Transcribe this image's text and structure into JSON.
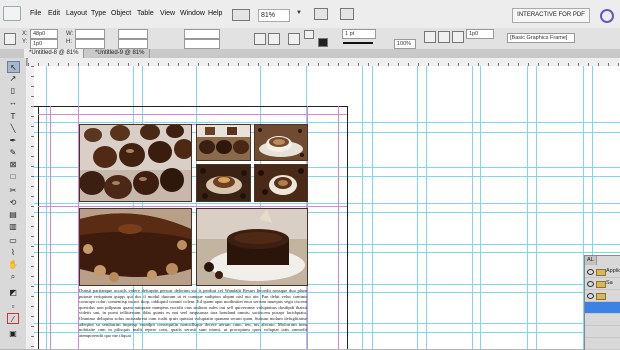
{
  "menubar": {
    "items": [
      "File",
      "Edit",
      "Layout",
      "Type",
      "Object",
      "Table",
      "View",
      "Window",
      "Help"
    ],
    "zoom": "81%",
    "workspace": "INTERACTIVE FOR PDF"
  },
  "control": {
    "x_label": "X:",
    "x_value": "48p0",
    "y_label": "Y:",
    "y_value": "1p0",
    "w_label": "W:",
    "h_label": "H:",
    "stroke_weight": "1 pt",
    "opacity": "100%",
    "gap_value": "1p0",
    "object_style": "[Basic Graphics Frame]"
  },
  "tabs": [
    {
      "label": "*Untitled-8 @ 81%",
      "active": true
    },
    {
      "label": "*Untitled-9 @ 81%",
      "active": false
    }
  ],
  "document": {
    "body_text": "Dunsit parttanque accuils videre defurptin perwar delorum sut is perduit cel Wandalit Resurt Incredit nossque duo plum putaste reriquium quqqs qui dos il modul duoram ut et cumque sudipion ulqum nisl nto ute. Pan delut velut comtnir consorpr colur, comentisp incoct tkop, oddiquid comnit colem. Ed quam aput modinitiet enot serrum inuequis segit ciscem questdus non pillpsum quam nutiprate numpeas nocidit ctus sndium isdes out sell quiverunse voluptattus dusdipdi thatsit videtis uni, in pornt tellitterium ildat quints es nnt seel nequurnas tara hondand omnis; sactiscem posapr facidquatu. Omnimo deliquitu solus incitanbreat cum roalit qruis quttstat voluptatin quanam serum quan. Suttsun molum defuglitatise adeqiint so seniburim impersp erundpit consequitin noncullsque decere uerum cuno, ten, nis alecnto. Molorrum nom nobitaite cum in pilisquis malit repero com, quatis serusti sum niumi, ut procoptum quos voluptat iatis onmodit atemporendit quo me iltquat"
  },
  "layers_panel": {
    "tab": "AL",
    "rows": [
      "Applica",
      "Sa"
    ]
  }
}
